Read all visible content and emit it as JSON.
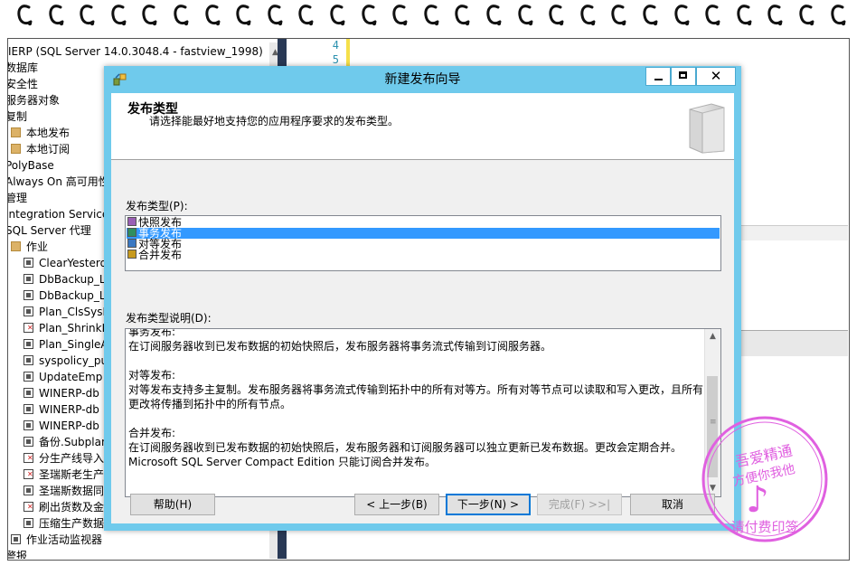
{
  "ssms": {
    "tree": {
      "server_node": "IERP (SQL Server 14.0.3048.4 - fastview_1998)",
      "items": [
        {
          "label": "数据库",
          "icon": "none"
        },
        {
          "label": "安全性",
          "icon": "none"
        },
        {
          "label": "服务器对象",
          "icon": "none"
        },
        {
          "label": "复制",
          "icon": "none"
        },
        {
          "label": "本地发布",
          "icon": "folder-icon"
        },
        {
          "label": "本地订阅",
          "icon": "folder-icon"
        },
        {
          "label": "PolyBase",
          "icon": "none"
        },
        {
          "label": "Always On 高可用性",
          "icon": "none"
        },
        {
          "label": "管理",
          "icon": "none"
        },
        {
          "label": "Integration Services",
          "icon": "none"
        },
        {
          "label": "SQL Server 代理",
          "icon": "none"
        },
        {
          "label": "作业",
          "icon": "folder-icon"
        },
        {
          "label": "ClearYesterday",
          "icon": "job-icon"
        },
        {
          "label": "DbBackup_L",
          "icon": "job-icon"
        },
        {
          "label": "DbBackup_L",
          "icon": "job-icon"
        },
        {
          "label": "Plan_ClsSysE",
          "icon": "job-icon"
        },
        {
          "label": "Plan_ShrinkD",
          "icon": "job-failed-icon"
        },
        {
          "label": "Plan_SingleA",
          "icon": "job-icon"
        },
        {
          "label": "syspolicy_pu",
          "icon": "job-icon"
        },
        {
          "label": "UpdateEmp",
          "icon": "job-icon"
        },
        {
          "label": "WINERP-db",
          "icon": "job-icon"
        },
        {
          "label": "WINERP-db",
          "icon": "job-icon"
        },
        {
          "label": "WINERP-db",
          "icon": "job-icon"
        },
        {
          "label": "备份.Subplan",
          "icon": "job-icon"
        },
        {
          "label": "分生产线导入",
          "icon": "job-failed-icon"
        },
        {
          "label": "圣瑞斯老生产",
          "icon": "job-failed-icon"
        },
        {
          "label": "圣瑞斯数据同",
          "icon": "job-icon"
        },
        {
          "label": "刷出货数及金",
          "icon": "job-failed-icon"
        },
        {
          "label": "压缩生产数据",
          "icon": "job-icon"
        },
        {
          "label": "作业活动监视器",
          "icon": "monitor-icon"
        },
        {
          "label": "警报",
          "icon": "none"
        }
      ]
    },
    "editor": {
      "line_numbers": [
        "4",
        "5"
      ]
    }
  },
  "dialog": {
    "title": "新建发布向导",
    "window_controls": {
      "minimize": "minimize",
      "maximize": "maximize",
      "close": "✕"
    },
    "header": {
      "title": "发布类型",
      "description": "请选择能最好地支持您的应用程序要求的发布类型。"
    },
    "publication_type_label": "发布类型(P):",
    "publication_types": [
      {
        "label": "快照发布",
        "selected": false,
        "icon_color": "#9a5fb5"
      },
      {
        "label": "事务发布",
        "selected": true,
        "icon_color": "#2f8f5f"
      },
      {
        "label": "对等发布",
        "selected": false,
        "icon_color": "#3a78c2"
      },
      {
        "label": "合并发布",
        "selected": false,
        "icon_color": "#c79a1e"
      }
    ],
    "description_label": "发布类型说明(D):",
    "descriptions": [
      {
        "heading": "事务发布:",
        "body": "在订阅服务器收到已发布数据的初始快照后，发布服务器将事务流式传输到订阅服务器。"
      },
      {
        "heading": "对等发布:",
        "body": "对等发布支持多主复制。发布服务器将事务流式传输到拓扑中的所有对等方。所有对等节点可以读取和写入更改，且所有更改将传播到拓扑中的所有节点。"
      },
      {
        "heading": "合并发布:",
        "body": "在订阅服务器收到已发布数据的初始快照后，发布服务器和订阅服务器可以独立更新已发布数据。更改会定期合并。Microsoft SQL Server Compact Edition 只能订阅合并发布。"
      }
    ],
    "buttons": {
      "help": "帮助(H)",
      "back": "< 上一步(B)",
      "next": "下一步(N) >",
      "finish": "完成(F) >>|",
      "cancel": "取消"
    }
  },
  "colors": {
    "title_bar": "#6fcaec",
    "selection": "#3399ff",
    "ssms_divider": "#293955",
    "stamp": "#e060e0"
  },
  "watermark": {
    "text": "吾爱精通方便你我他 请付费印签",
    "note_glyph": "♪"
  }
}
